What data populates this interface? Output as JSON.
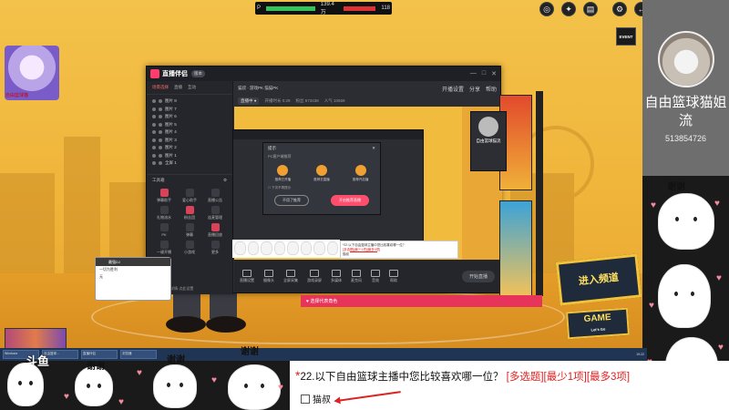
{
  "hud": {
    "left_score": "139.4万",
    "right_score": "118",
    "left_tag": "P"
  },
  "top_icons": [
    "camera-icon",
    "gift-icon",
    "menu-icon",
    "gear-icon",
    "back-arrow-icon"
  ],
  "event_badge": "EVENT",
  "character": {
    "name": "自由篮球猫"
  },
  "app": {
    "name": "直播伴侣",
    "version": "版本",
    "side_tabs": [
      "场景选择",
      "直播",
      "互动"
    ],
    "scenes": [
      "图片 8",
      "图片 7",
      "图片 6",
      "图片 5",
      "图片 4",
      "图片 3",
      "图片 2",
      "图片 1",
      "全屏 1"
    ],
    "tools_title": "工具箱",
    "tools": [
      "弹幕助手",
      "爱心助手",
      "直播公告",
      "礼物流水",
      "粉丝团",
      "连麦管理",
      "PK",
      "弹幕",
      "直播回放",
      "一键开播",
      "小游戏",
      "更多"
    ],
    "footer": "分离直播间详情·点此设置",
    "top_title": "猫叔 · 游戏PK 猫猫PK",
    "top_links": [
      "开播设置",
      "分享",
      "帮助"
    ],
    "sub_chips": [
      "直播中 ●",
      "开播时长 0:29",
      "粉丝 573438",
      "人气 10559"
    ],
    "bottom_tools": [
      "直播设置",
      "摄像头",
      "全屏采集",
      "游戏录屏",
      "多媒体",
      "麦克风",
      "音效",
      "帮助"
    ],
    "start_label": "开始直播",
    "choose_label": "选择代表角色"
  },
  "dialog": {
    "title": "提示",
    "subtitle": "PC客户端推荐",
    "options": [
      "推荐已开播",
      "推荐去直播",
      "推荐开启播"
    ],
    "checkbox": "下次不再提示",
    "cancel": "不用了推荐",
    "confirm": "开启推荐直播"
  },
  "mini_survey": {
    "q": "*22.以下自由篮球主播中您比较喜欢哪一位？",
    "tag": "[多选题][最少1项][最多3项]",
    "opt": "猫叔"
  },
  "chat_popup": {
    "header": "最强DJ",
    "rows": [
      "一切为胜利",
      "无"
    ]
  },
  "streamer_mini": {
    "name": "自由篮球猫流"
  },
  "join_sign": "进入频道",
  "game_sign": {
    "title": "GAME",
    "sub": "Let's Go"
  },
  "taskbar": {
    "items": [
      "Windows",
      "自由篮球...",
      "直播伴侣",
      "浏览器"
    ],
    "clock": "19:22"
  },
  "profile": {
    "name": "自由篮球猫姐流",
    "id": "513854726"
  },
  "stickers": {
    "thanks": "谢谢"
  },
  "logo_watermark": "斗鱼",
  "survey": {
    "number": "22.",
    "question": "以下自由篮球主播中您比较喜欢哪一位？",
    "tags": "[多选题][最少1项][最多3项]",
    "option": "猫叔"
  }
}
